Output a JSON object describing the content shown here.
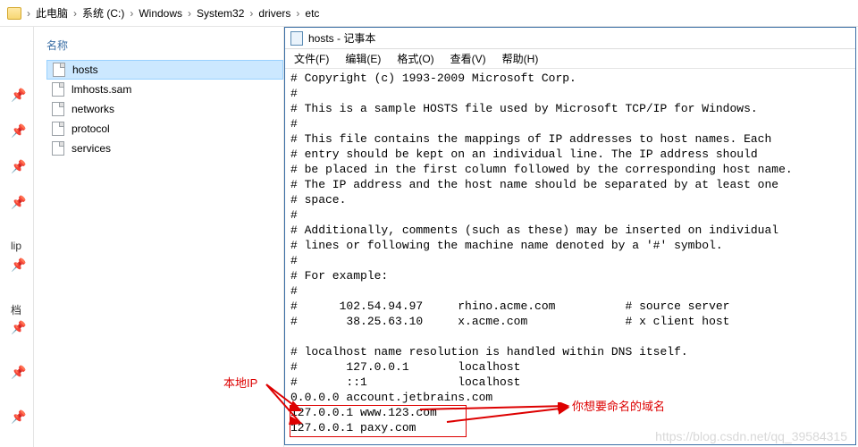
{
  "breadcrumb": [
    "此电脑",
    "系统 (C:)",
    "Windows",
    "System32",
    "drivers",
    "etc"
  ],
  "sidebar": {
    "header": "名称",
    "files": [
      "hosts",
      "lmhosts.sam",
      "networks",
      "protocol",
      "services"
    ],
    "pinned_truncated": [
      "lip",
      "档"
    ]
  },
  "notepad": {
    "title": "hosts - 记事本",
    "menu": [
      "文件(F)",
      "编辑(E)",
      "格式(O)",
      "查看(V)",
      "帮助(H)"
    ],
    "content": "# Copyright (c) 1993-2009 Microsoft Corp.\n#\n# This is a sample HOSTS file used by Microsoft TCP/IP for Windows.\n#\n# This file contains the mappings of IP addresses to host names. Each\n# entry should be kept on an individual line. The IP address should\n# be placed in the first column followed by the corresponding host name.\n# The IP address and the host name should be separated by at least one\n# space.\n#\n# Additionally, comments (such as these) may be inserted on individual\n# lines or following the machine name denoted by a '#' symbol.\n#\n# For example:\n#\n#      102.54.94.97     rhino.acme.com          # source server\n#       38.25.63.10     x.acme.com              # x client host\n\n# localhost name resolution is handled within DNS itself.\n#       127.0.0.1       localhost\n#       ::1             localhost\n0.0.0.0 account.jetbrains.com\n127.0.0.1 www.123.com\n127.0.0.1 paxy.com"
  },
  "annotations": {
    "left": "本地IP",
    "right": "你想要命名的域名"
  },
  "watermark": "https://blog.csdn.net/qq_39584315"
}
